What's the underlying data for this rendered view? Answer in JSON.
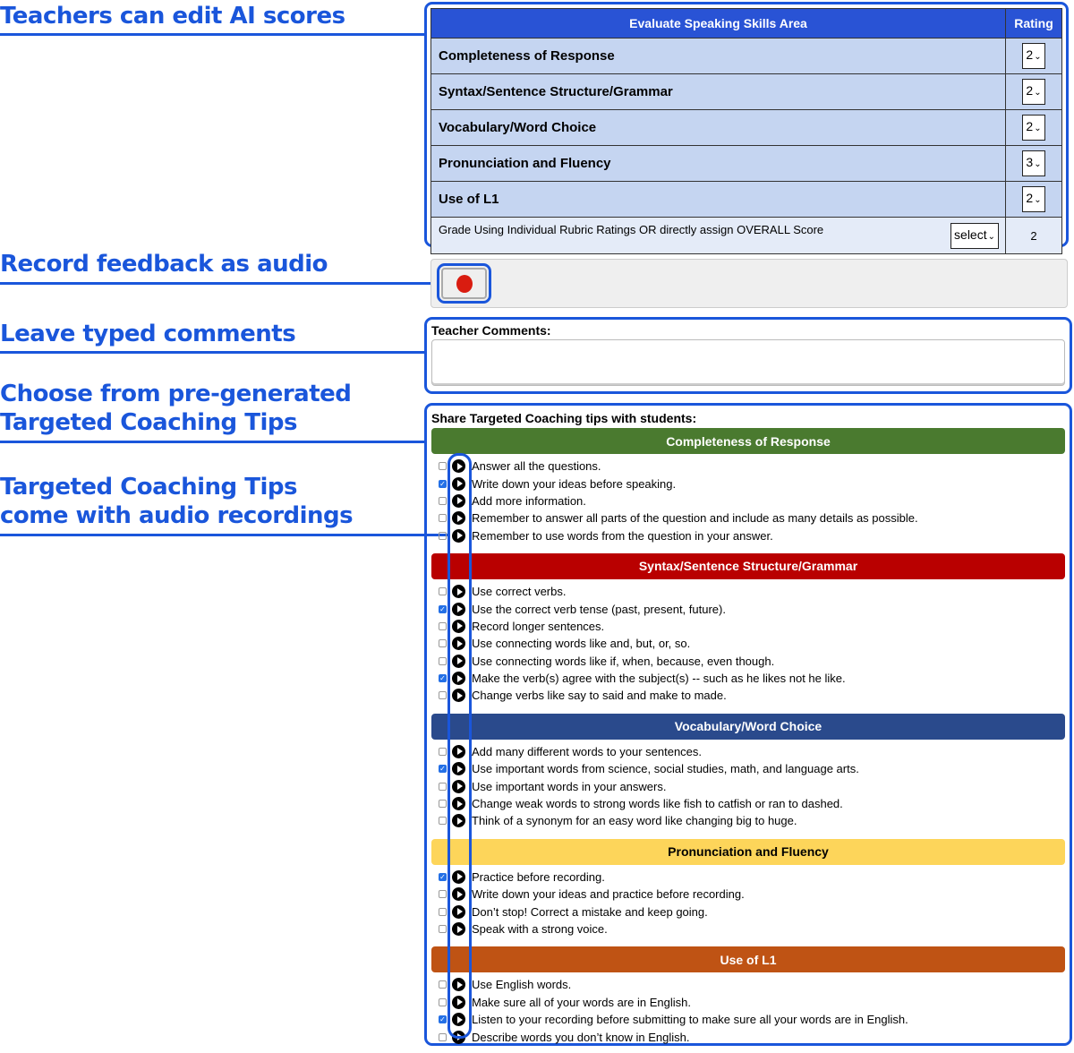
{
  "callouts": [
    {
      "text": "Teachers can edit AI scores"
    },
    {
      "text": "Record feedback as audio"
    },
    {
      "text": "Leave typed comments"
    },
    {
      "line1": "Choose from pre-generated",
      "line2": "Targeted Coaching Tips"
    },
    {
      "line1": "Targeted Coaching Tips",
      "line2": "come with audio recordings"
    }
  ],
  "rubric": {
    "header_area": "Evaluate Speaking Skills Area",
    "header_rating": "Rating",
    "rows": [
      {
        "label": "Completeness of Response",
        "rating": "2"
      },
      {
        "label": "Syntax/Sentence Structure/Grammar",
        "rating": "2"
      },
      {
        "label": "Vocabulary/Word Choice",
        "rating": "2"
      },
      {
        "label": "Pronunciation and Fluency",
        "rating": "3"
      },
      {
        "label": "Use of L1",
        "rating": "2"
      }
    ],
    "overall_label": "Grade Using Individual Rubric Ratings OR directly assign OVERALL Score",
    "overall_select": "select",
    "overall_value": "2"
  },
  "record": {
    "icon": "record-icon"
  },
  "comments": {
    "label": "Teacher Comments:",
    "value": ""
  },
  "tips": {
    "title": "Share Targeted Coaching tips with students:",
    "categories": [
      {
        "name": "Completeness of Response",
        "color": "#4a7a2f",
        "text_color": "#ffffff",
        "items": [
          {
            "text": "Answer all the questions.",
            "checked": false
          },
          {
            "text": "Write down your ideas before speaking.",
            "checked": true
          },
          {
            "text": "Add more information.",
            "checked": false
          },
          {
            "text": "Remember to answer all parts of the question and include as many details as possible.",
            "checked": false
          },
          {
            "text": "Remember to use words from the question in your answer.",
            "checked": false
          }
        ]
      },
      {
        "name": "Syntax/Sentence Structure/Grammar",
        "color": "#b90000",
        "text_color": "#ffffff",
        "items": [
          {
            "text": "Use correct verbs.",
            "checked": false
          },
          {
            "text": "Use the correct verb tense (past, present, future).",
            "checked": true
          },
          {
            "text": "Record longer sentences.",
            "checked": false
          },
          {
            "text": "Use connecting words like and, but, or, so.",
            "checked": false
          },
          {
            "text": "Use connecting words like if, when, because, even though.",
            "checked": false
          },
          {
            "text": "Make the verb(s) agree with the subject(s) -- such as he likes not he like.",
            "checked": true
          },
          {
            "text": "Change verbs like say to said and make to made.",
            "checked": false
          }
        ]
      },
      {
        "name": "Vocabulary/Word Choice",
        "color": "#2a4a8c",
        "text_color": "#ffffff",
        "items": [
          {
            "text": "Add many different words to your sentences.",
            "checked": false
          },
          {
            "text": "Use important words from science, social studies, math, and language arts.",
            "checked": true
          },
          {
            "text": "Use important words in your answers.",
            "checked": false
          },
          {
            "text": "Change weak words to strong words like fish to catfish or ran to dashed.",
            "checked": false
          },
          {
            "text": "Think of a synonym for an easy word like changing big to huge.",
            "checked": false
          }
        ]
      },
      {
        "name": "Pronunciation and Fluency",
        "color": "#fdd55a",
        "text_color": "#000000",
        "items": [
          {
            "text": "Practice before recording.",
            "checked": true
          },
          {
            "text": "Write down your ideas and practice before recording.",
            "checked": false
          },
          {
            "text": "Don’t stop! Correct a mistake and keep going.",
            "checked": false
          },
          {
            "text": "Speak with a strong voice.",
            "checked": false
          }
        ]
      },
      {
        "name": "Use of L1",
        "color": "#bf5314",
        "text_color": "#ffffff",
        "items": [
          {
            "text": "Use English words.",
            "checked": false
          },
          {
            "text": "Make sure all of your words are in English.",
            "checked": false
          },
          {
            "text": "Listen to your recording before submitting to make sure all your words are in English.",
            "checked": true
          },
          {
            "text": "Describe words you don’t know in English.",
            "checked": false
          }
        ]
      }
    ]
  }
}
